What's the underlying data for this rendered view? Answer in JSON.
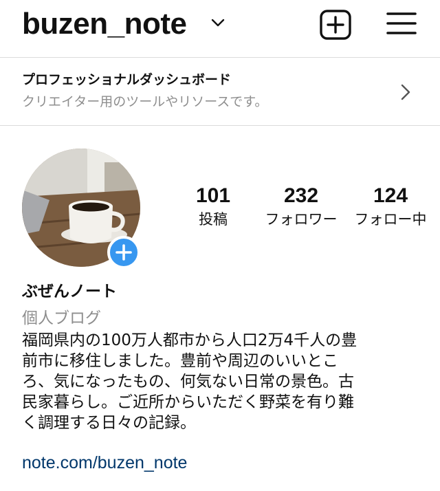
{
  "header": {
    "username": "buzen_note",
    "icons": [
      "chevron-down-icon",
      "add-content-icon",
      "menu-icon"
    ]
  },
  "dashboard": {
    "title": "プロフェッショナルダッシュボード",
    "subtitle": "クリエイター用のツールやリソースです。"
  },
  "stats": {
    "posts": {
      "value": "101",
      "label": "投稿"
    },
    "followers": {
      "value": "232",
      "label": "フォロワー"
    },
    "following": {
      "value": "124",
      "label": "フォロー中"
    }
  },
  "profile": {
    "display_name": "ぶぜんノート",
    "category": "個人ブログ",
    "bio_lines": [
      "福岡県内の100万人都市から人口2万4千人の豊",
      "前市に移住しました。豊前や周辺のいいとこ",
      "ろ、気になったもの、何気ない日常の景色。古",
      "民家暮らし。ご近所からいただく野菜を有り難",
      "く調理する日々の記録。"
    ],
    "link": "note.com/buzen_note"
  },
  "colors": {
    "link": "#00376b",
    "secondary_text": "#8e8e8e",
    "add_badge": "#3797f0",
    "divider": "#dbdbdb"
  }
}
